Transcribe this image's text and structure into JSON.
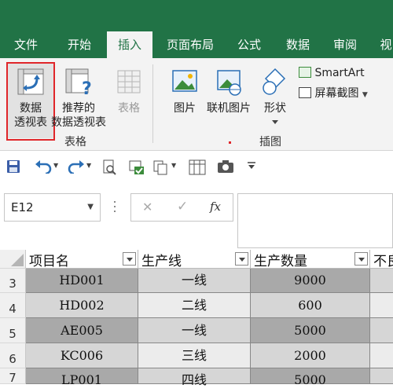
{
  "tabs": [
    "文件",
    "开始",
    "插入",
    "页面布局",
    "公式",
    "数据",
    "审阅",
    "视"
  ],
  "active_tab": "插入",
  "ribbon": {
    "pivot_table": [
      "数据",
      "透视表"
    ],
    "recommended_pivot": [
      "推荐的",
      "数据透视表"
    ],
    "table": "表格",
    "tables_group": "表格",
    "picture": "图片",
    "online_picture": "联机图片",
    "shapes": "形状",
    "smartart": "SmartArt",
    "screenshot": "屏幕截图",
    "illustrations_group": "插图"
  },
  "formula_bar": {
    "name_box": "E12",
    "cancel_icon": "✕",
    "enter_icon": "✓",
    "fx": "fx",
    "value": ""
  },
  "sheet": {
    "headers": [
      "项目名",
      "生产线",
      "生产数量",
      "不良"
    ],
    "rows": [
      {
        "num": "3",
        "name": "HD001",
        "line": "一线",
        "qty": "9000"
      },
      {
        "num": "4",
        "name": "HD002",
        "line": "二线",
        "qty": "600"
      },
      {
        "num": "5",
        "name": "AE005",
        "line": "一线",
        "qty": "5000"
      },
      {
        "num": "6",
        "name": "KC006",
        "line": "三线",
        "qty": "2000"
      },
      {
        "num": "7",
        "name": "LP001",
        "line": "四线",
        "qty": "5000"
      }
    ]
  },
  "colors": {
    "excel_green": "#217346",
    "highlight_red": "#e0262a",
    "row_dark": "#a9a9a9",
    "row_light": "#d6d6d6"
  }
}
